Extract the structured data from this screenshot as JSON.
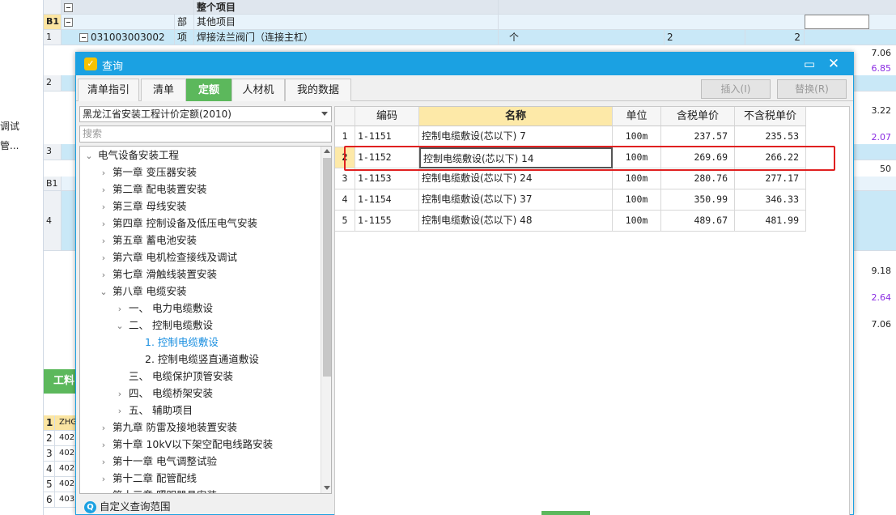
{
  "background": {
    "left_labels": [
      "调试",
      "管..."
    ],
    "header_title": "整个项目",
    "rows": [
      {
        "rn": "B1",
        "type": "部",
        "name": "其他项目"
      },
      {
        "rn": "1",
        "code": "031003003002",
        "type": "项",
        "name": "焊接法兰阀门（连接主杠）",
        "unit": "个",
        "qty": "2",
        "qty2": "2"
      },
      {
        "rn": "2"
      },
      {
        "rn": "3"
      },
      {
        "rn": "B1"
      },
      {
        "rn": "4"
      }
    ],
    "right_values": [
      "7.06",
      "6.85",
      "3.22",
      "2.07",
      "50",
      "9.18",
      "2.64",
      "7.06"
    ],
    "material_label": "工料",
    "bottom_rows": [
      {
        "rn": "1",
        "code": "ZHG"
      },
      {
        "rn": "2",
        "code": "402"
      },
      {
        "rn": "3",
        "code": "402"
      },
      {
        "rn": "4",
        "code": "402"
      },
      {
        "rn": "5",
        "code": "402"
      },
      {
        "rn": "6",
        "code": "403"
      }
    ]
  },
  "dialog": {
    "title": "查询",
    "tabs": [
      "清单指引",
      "清单",
      "定额",
      "人材机",
      "我的数据"
    ],
    "active_tab": 2,
    "insert_button": "插入(I)",
    "replace_button": "替换(R)",
    "quota_selector": "黑龙江省安装工程计价定额(2010)",
    "search_placeholder": "搜索",
    "tree": [
      {
        "label": "电气设备安装工程",
        "level": 0,
        "state": "open"
      },
      {
        "label": "第一章 变压器安装",
        "level": 1,
        "state": "closed"
      },
      {
        "label": "第二章 配电装置安装",
        "level": 1,
        "state": "closed"
      },
      {
        "label": "第三章 母线安装",
        "level": 1,
        "state": "closed"
      },
      {
        "label": "第四章 控制设备及低压电气安装",
        "level": 1,
        "state": "closed"
      },
      {
        "label": "第五章 蓄电池安装",
        "level": 1,
        "state": "closed"
      },
      {
        "label": "第六章 电机检查接线及调试",
        "level": 1,
        "state": "closed"
      },
      {
        "label": "第七章 滑触线装置安装",
        "level": 1,
        "state": "closed"
      },
      {
        "label": "第八章 电缆安装",
        "level": 1,
        "state": "open"
      },
      {
        "label": "一、 电力电缆敷设",
        "level": 2,
        "state": "closed"
      },
      {
        "label": "二、 控制电缆敷设",
        "level": 2,
        "state": "open"
      },
      {
        "label": "1. 控制电缆敷设",
        "level": 3,
        "state": "leaf",
        "selected": true
      },
      {
        "label": "2. 控制电缆竖直通道敷设",
        "level": 3,
        "state": "leaf"
      },
      {
        "label": "三、 电缆保护顶管安装",
        "level": 2,
        "state": "leaf"
      },
      {
        "label": "四、 电缆桥架安装",
        "level": 2,
        "state": "closed"
      },
      {
        "label": "五、 辅助项目",
        "level": 2,
        "state": "closed"
      },
      {
        "label": "第九章 防雷及接地装置安装",
        "level": 1,
        "state": "closed"
      },
      {
        "label": "第十章 10kV以下架空配电线路安装",
        "level": 1,
        "state": "closed"
      },
      {
        "label": "第十一章 电气调整试验",
        "level": 1,
        "state": "closed"
      },
      {
        "label": "第十二章 配管配线",
        "level": 1,
        "state": "closed"
      },
      {
        "label": "第十三章 照明器具安装",
        "level": 1,
        "state": "closed"
      }
    ],
    "custom_query_label": "自定义查询范围",
    "table": {
      "headers": [
        "编码",
        "名称",
        "单位",
        "含税单价",
        "不含税单价"
      ],
      "rows": [
        {
          "idx": "1",
          "code": "1-1151",
          "name": "控制电缆敷设(芯以下) 7",
          "unit": "100m",
          "price_tax": "237.57",
          "price_notax": "235.53"
        },
        {
          "idx": "2",
          "code": "1-1152",
          "name": "控制电缆敷设(芯以下) 14",
          "unit": "100m",
          "price_tax": "269.69",
          "price_notax": "266.22"
        },
        {
          "idx": "3",
          "code": "1-1153",
          "name": "控制电缆敷设(芯以下) 24",
          "unit": "100m",
          "price_tax": "280.76",
          "price_notax": "277.17"
        },
        {
          "idx": "4",
          "code": "1-1154",
          "name": "控制电缆敷设(芯以下) 37",
          "unit": "100m",
          "price_tax": "350.99",
          "price_notax": "346.33"
        },
        {
          "idx": "5",
          "code": "1-1155",
          "name": "控制电缆敷设(芯以下) 48",
          "unit": "100m",
          "price_tax": "489.67",
          "price_notax": "481.99"
        }
      ],
      "selected_row": 1
    }
  },
  "colors": {
    "accent": "#1ba1e2",
    "active_tab": "#5cb85c",
    "highlight": "#fde9a8",
    "red_box": "#e02020"
  }
}
